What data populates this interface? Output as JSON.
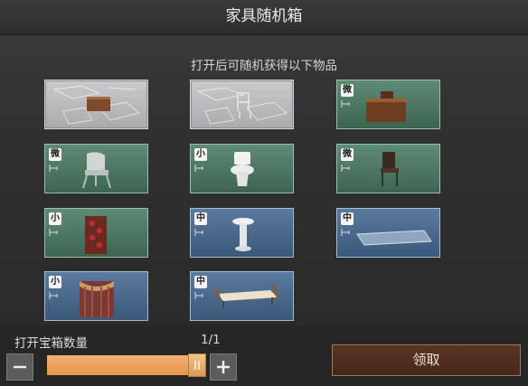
{
  "header": {
    "title": "家具随机箱"
  },
  "subtitle": "打开后可随机获得以下物品",
  "items": [
    {
      "tier": "",
      "style": "paper",
      "icon": "desk-blueprint-icon"
    },
    {
      "tier": "",
      "style": "paper",
      "icon": "chair-blueprint-icon"
    },
    {
      "tier": "微",
      "style": "green",
      "icon": "cabinet-icon"
    },
    {
      "tier": "微",
      "style": "green",
      "icon": "armchair-icon"
    },
    {
      "tier": "小",
      "style": "green",
      "icon": "toilet-icon"
    },
    {
      "tier": "微",
      "style": "green",
      "icon": "wooden-chair-icon"
    },
    {
      "tier": "小",
      "style": "green",
      "icon": "floral-cabinet-icon"
    },
    {
      "tier": "中",
      "style": "blue",
      "icon": "pedestal-sink-icon"
    },
    {
      "tier": "中",
      "style": "blue",
      "icon": "rug-icon"
    },
    {
      "tier": "小",
      "style": "blue",
      "icon": "curtain-stage-icon"
    },
    {
      "tier": "中",
      "style": "blue",
      "icon": "chaise-lounge-icon"
    }
  ],
  "bottom": {
    "qty_label": "打开宝箱数量",
    "qty_count": "1/1",
    "slider_fraction": 1.0,
    "minus_icon": "minus-icon",
    "plus_icon": "plus-icon",
    "claim_label": "领取"
  },
  "colors": {
    "accent": "#e8954a",
    "claim_bg": "#4e2e1e"
  }
}
